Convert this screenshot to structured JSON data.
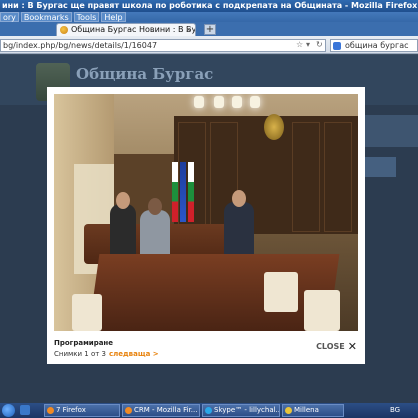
{
  "window": {
    "title": "ини : В Бургас ще правят школа по роботика с подкрепата на Общината - Mozilla Firefox"
  },
  "menubar": {
    "items": [
      "ory",
      "Bookmarks",
      "Tools",
      "Help"
    ]
  },
  "tabs": [
    {
      "label": "Община Бургас Новини : В Бургас ще ...",
      "active": true
    },
    {
      "label": "",
      "active": false
    }
  ],
  "navbar": {
    "url": "bg/index.php/bg/news/details/1/16047",
    "search_text": "община бургас"
  },
  "site": {
    "title": "Община Бургас"
  },
  "lightbox": {
    "caption": "Програмиране",
    "counter": "Снимки 1 от 3",
    "next_label": "следваща >",
    "close_label": "CLOSE"
  },
  "taskbar": {
    "items": [
      {
        "label": "7 Firefox"
      },
      {
        "label": "CRM - Mozilla Fir..."
      },
      {
        "label": "Skype™ - lillychal..."
      },
      {
        "label": "Millena"
      }
    ],
    "tray_lang": "BG"
  }
}
